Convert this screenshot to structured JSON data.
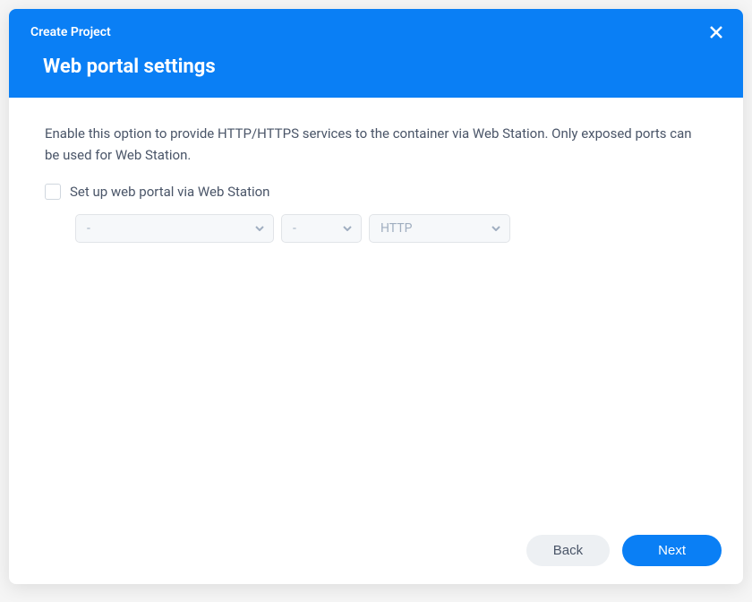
{
  "header": {
    "breadcrumb": "Create Project",
    "title": "Web portal settings"
  },
  "description": "Enable this option to provide HTTP/HTTPS services to the container via Web Station. Only exposed ports can be used for Web Station.",
  "checkbox": {
    "label": "Set up web portal via Web Station"
  },
  "selects": {
    "service": "-",
    "port": "-",
    "protocol": "HTTP"
  },
  "footer": {
    "back": "Back",
    "next": "Next"
  }
}
